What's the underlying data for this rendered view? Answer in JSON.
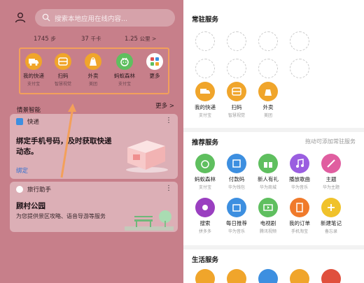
{
  "left": {
    "search": {
      "placeholder": "搜索本地应用在线内容..."
    },
    "stats": [
      {
        "value": "1745",
        "unit": "步"
      },
      {
        "value": "37",
        "unit": "千卡"
      },
      {
        "value": "1.25",
        "unit": "公里 >"
      }
    ],
    "quick": [
      {
        "label": "我的快递",
        "sub": "支付宝",
        "color": "#f0a52b",
        "icon": "truck-icon"
      },
      {
        "label": "扫码",
        "sub": "智慧视觉",
        "color": "#f0a52b",
        "icon": "scan-icon"
      },
      {
        "label": "外卖",
        "sub": "美团",
        "color": "#f0a52b",
        "icon": "takeout-icon"
      },
      {
        "label": "蚂蚁森林",
        "sub": "支付宝",
        "color": "#5fbf5f",
        "icon": "forest-icon"
      },
      {
        "label": "更多",
        "sub": "",
        "color": "#ffffff",
        "icon": "more-grid-icon"
      }
    ],
    "section": {
      "title": "情景智能",
      "more": "更多 >"
    },
    "card1": {
      "header": "快递",
      "main": "绑定手机号码，及时获取快递动态。",
      "action": "绑定"
    },
    "card2": {
      "header": "旅行助手",
      "main": "顾村公园",
      "sub": "为您提供景区攻略、语音导游等服务"
    },
    "highlight_color": "#f3a05a"
  },
  "right": {
    "resident": {
      "title": "常驻服务"
    },
    "resident_services": [
      {
        "label": "我的快递",
        "sub": "支付宝",
        "color": "#f0a52b",
        "icon": "truck-icon"
      },
      {
        "label": "扫码",
        "sub": "智慧视觉",
        "color": "#f0a52b",
        "icon": "scan-icon"
      },
      {
        "label": "外卖",
        "sub": "美团",
        "color": "#f0a52b",
        "icon": "takeout-icon"
      }
    ],
    "recommend": {
      "title": "推荐服务",
      "hint": "拖动可添加常驻服务"
    },
    "recommend_services": [
      {
        "label": "蚂蚁森林",
        "sub": "支付宝",
        "color": "#5fbf5f",
        "icon": "forest-icon"
      },
      {
        "label": "付款码",
        "sub": "华为钱包",
        "color": "#3d8fe0",
        "icon": "paycode-icon"
      },
      {
        "label": "新人有礼",
        "sub": "华为商城",
        "color": "#5fbf5f",
        "icon": "gift-icon"
      },
      {
        "label": "播放歌曲",
        "sub": "华为音乐",
        "color": "#9a5ee0",
        "icon": "music-icon"
      },
      {
        "label": "主题",
        "sub": "华为主题",
        "color": "#e05ea0",
        "icon": "theme-icon"
      },
      {
        "label": "搜索",
        "sub": "拼多多",
        "color": "#9a3fc0",
        "icon": "search-icon"
      },
      {
        "label": "每日推荐",
        "sub": "华为音乐",
        "color": "#3d8fe0",
        "icon": "calendar-icon"
      },
      {
        "label": "电视剧",
        "sub": "腾讯视频",
        "color": "#5fbf5f",
        "icon": "tv-icon"
      },
      {
        "label": "我的订单",
        "sub": "手机淘宝",
        "color": "#f07a2b",
        "icon": "order-icon"
      },
      {
        "label": "新建笔记",
        "sub": "备忘录",
        "color": "#f0c22b",
        "icon": "plus-icon"
      }
    ],
    "life": {
      "title": "生活服务"
    },
    "life_colors": [
      "#f0a52b",
      "#f0a52b",
      "#3d8fe0",
      "#f0a52b",
      "#e0503d"
    ]
  }
}
